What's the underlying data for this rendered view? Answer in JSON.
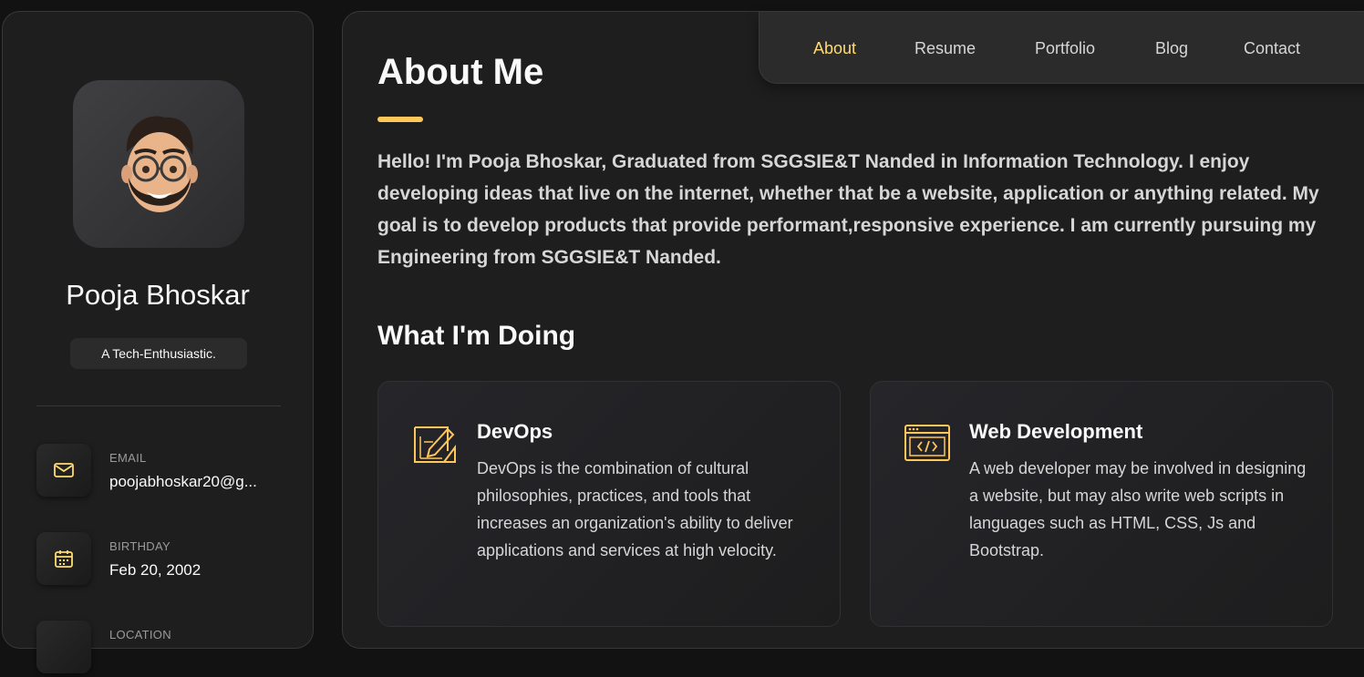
{
  "colors": {
    "accent": "#ffdb70",
    "bar": "#ffc65a",
    "bg": "#121212",
    "panel": "#1e1e1f"
  },
  "sidebar": {
    "name": "Pooja Bhoskar",
    "title": "A Tech-Enthusiastic.",
    "contacts": [
      {
        "icon": "mail-icon",
        "label": "EMAIL",
        "value": "poojabhoskar20@g..."
      },
      {
        "icon": "calendar-icon",
        "label": "BIRTHDAY",
        "value": "Feb 20, 2002"
      },
      {
        "icon": "location-icon",
        "label": "LOCATION",
        "value": ""
      }
    ]
  },
  "nav": {
    "items": [
      "About",
      "Resume",
      "Portfolio",
      "Blog",
      "Contact"
    ],
    "active": "About"
  },
  "about": {
    "title": "About Me",
    "text": "Hello! I'm Pooja Bhoskar, Graduated from SGGSIE&T Nanded in Information Technology. I enjoy developing ideas that live on the internet, whether that be a website, application or anything related. My goal is to develop products that provide performant,responsive experience. I am currently pursuing my Engineering from SGGSIE&T Nanded."
  },
  "services": {
    "title": "What I'm Doing",
    "items": [
      {
        "icon": "design-tools-icon",
        "title": "DevOps",
        "text": "DevOps is the combination of cultural philosophies, practices, and tools that increases an organization's ability to deliver applications and services at high velocity."
      },
      {
        "icon": "code-window-icon",
        "title": "Web Development",
        "text": "A web developer may be involved in designing a website, but may also write web scripts in languages such as HTML, CSS, Js and Bootstrap."
      }
    ]
  }
}
